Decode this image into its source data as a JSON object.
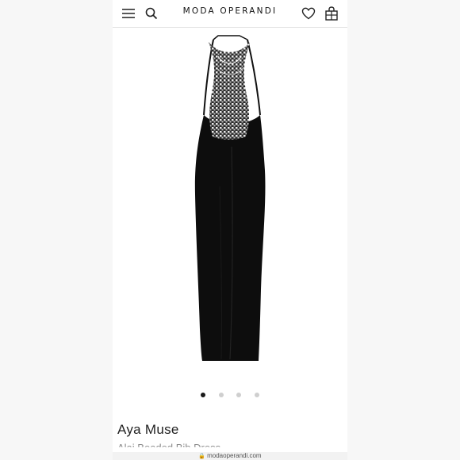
{
  "header": {
    "brand": "MODA OPERANDI",
    "menu_icon": "menu-icon",
    "search_icon": "search-icon",
    "wishlist_icon": "heart-icon",
    "bag_icon": "shopping-bag-icon"
  },
  "gallery": {
    "image_alt": "Black halter maxi dress with beaded bib",
    "slides": 4,
    "active_slide": 1
  },
  "product": {
    "designer": "Aya Muse",
    "name": "Alai Beaded Bib Dress"
  },
  "browser": {
    "url": "modaoperandi.com"
  }
}
